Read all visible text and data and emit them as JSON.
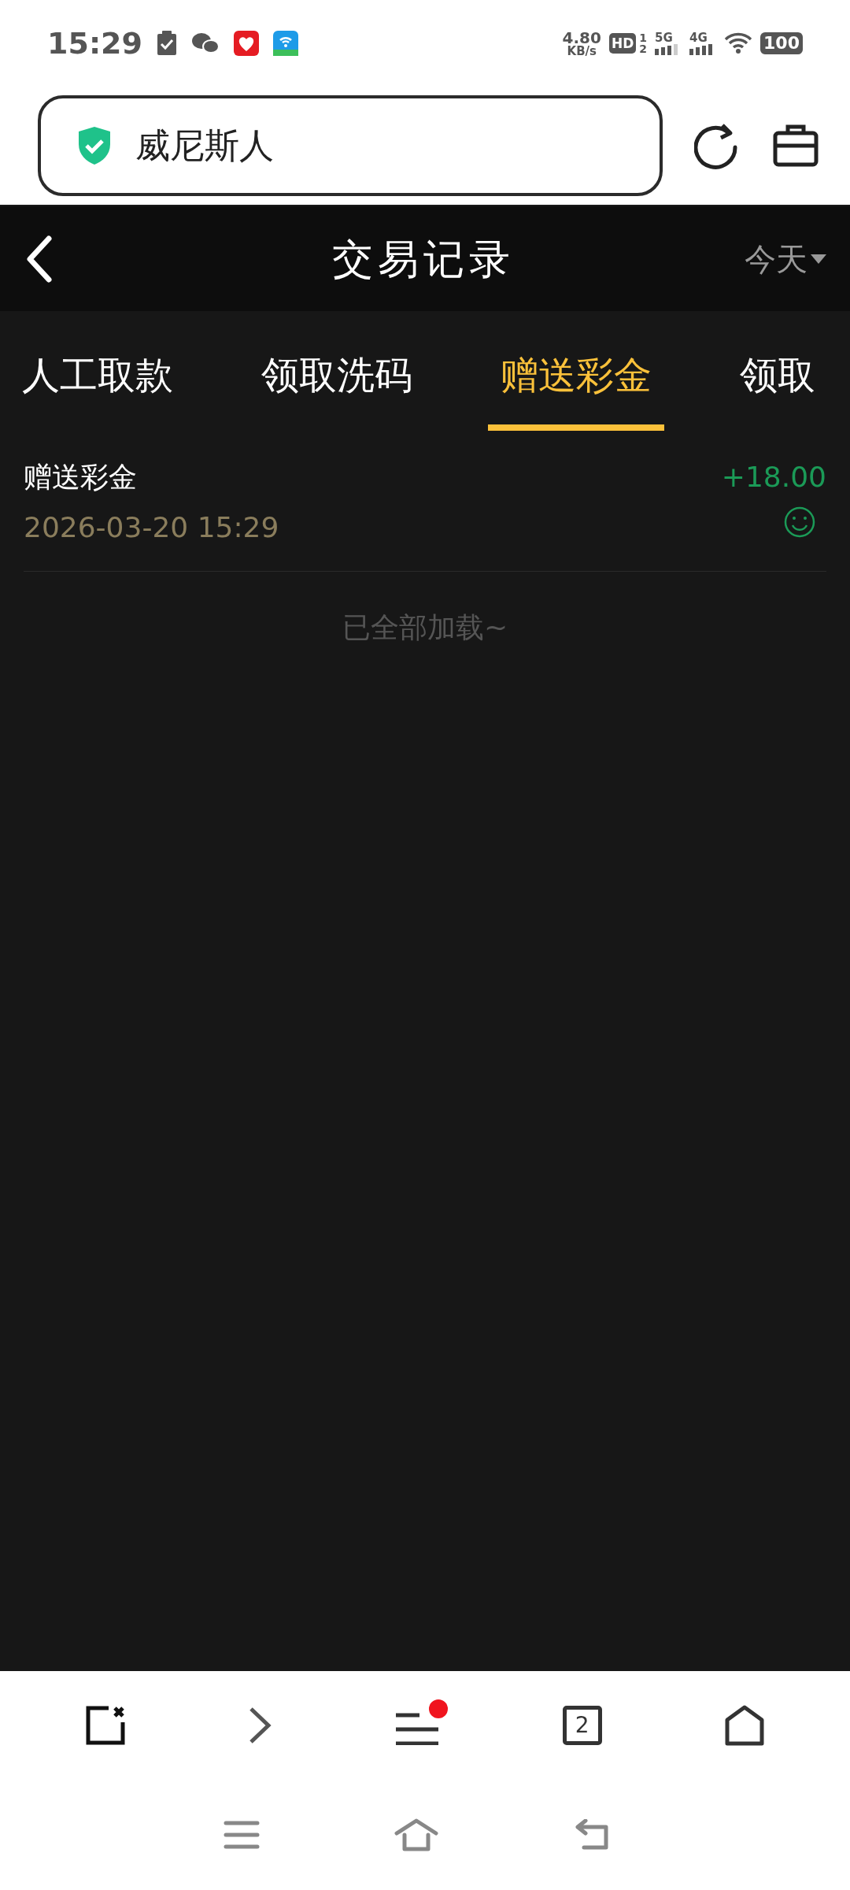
{
  "status_bar": {
    "time": "15:29",
    "net_speed": "4.80",
    "net_unit": "KB/s",
    "hd": "HD",
    "sim_labels": [
      "1",
      "2"
    ],
    "signal_labels": [
      "5G",
      "4G"
    ],
    "battery": "100"
  },
  "address_bar": {
    "value": "威尼斯人"
  },
  "header": {
    "title": "交易记录",
    "filter": "今天"
  },
  "tabs": [
    {
      "label": "人工取款",
      "selected": false
    },
    {
      "label": "领取洗码",
      "selected": false
    },
    {
      "label": "赠送彩金",
      "selected": true
    },
    {
      "label": "领取",
      "selected": false
    }
  ],
  "records": [
    {
      "title": "赠送彩金",
      "time": "2026-03-20 15:29",
      "amount": "+18.00"
    }
  ],
  "end_note": "已全部加载~",
  "toolbar": {
    "tab_count": "2",
    "has_notification": true
  }
}
